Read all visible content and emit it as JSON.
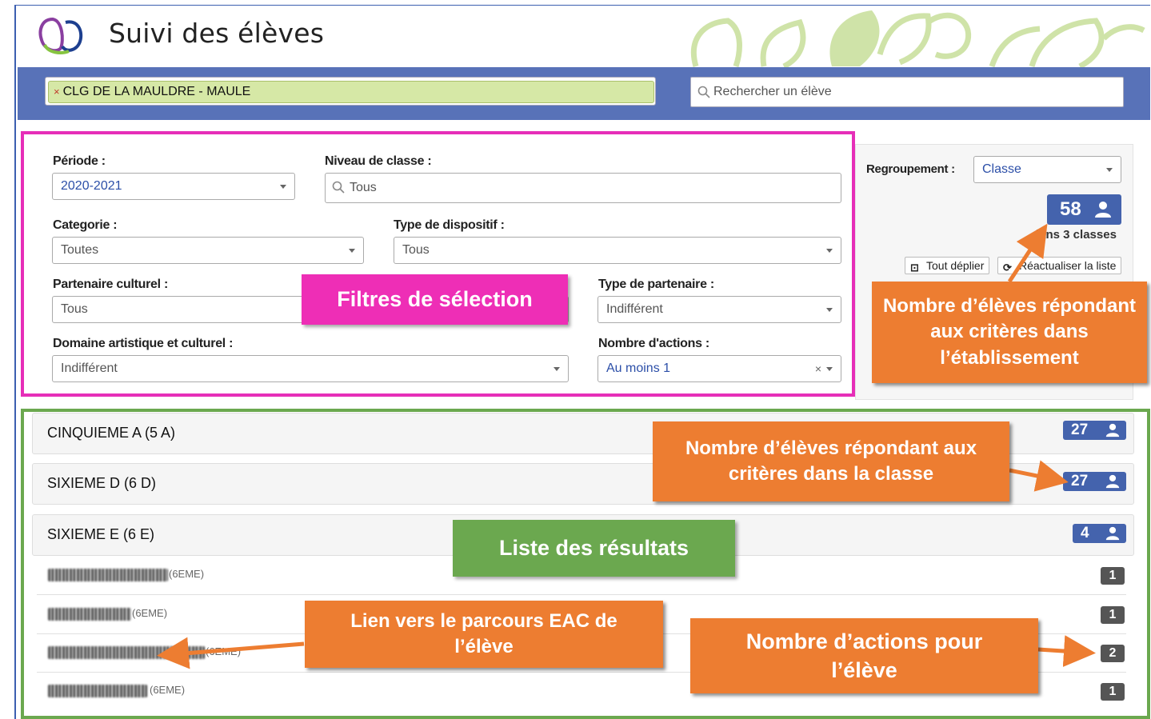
{
  "header": {
    "title": "Suivi des élèves"
  },
  "topbar": {
    "school_tag_remove": "×",
    "school_tag": "CLG DE LA MAULDRE - MAULE",
    "search_placeholder": "Rechercher un élève"
  },
  "filters": {
    "periode_label": "Période :",
    "periode_value": "2020-2021",
    "niveau_label": "Niveau de classe :",
    "niveau_value": "Tous",
    "categorie_label": "Categorie :",
    "categorie_value": "Toutes",
    "dispositif_label": "Type de dispositif :",
    "dispositif_value": "Tous",
    "partenaire_label": "Partenaire culturel :",
    "partenaire_value": "Tous",
    "type_partenaire_label": "Type de partenaire :",
    "type_partenaire_value": "Indifférent",
    "domaine_label": "Domaine artistique et culturel :",
    "domaine_value": "Indifférent",
    "nb_actions_label": "Nombre d'actions :",
    "nb_actions_value": "Au moins 1",
    "nb_actions_clear": "×"
  },
  "grouping": {
    "label": "Regroupement :",
    "value": "Classe",
    "total": "58",
    "classes_count": "dans 3 classes",
    "expand_label": "Tout déplier",
    "refresh_label": "Réactualiser la liste"
  },
  "results": {
    "groups": [
      {
        "title": "CINQUIEME A (5 A)",
        "count": "27"
      },
      {
        "title": "SIXIEME D (6 D)",
        "count": "27"
      },
      {
        "title": "SIXIEME E (6 E)",
        "count": "4"
      }
    ],
    "students": [
      {
        "level": "(6EME)",
        "actions": "1"
      },
      {
        "level": "(6EME)",
        "actions": "1"
      },
      {
        "level": "(6EME)",
        "actions": "2"
      },
      {
        "level": "(6EME)",
        "actions": "1"
      }
    ]
  },
  "annotations": {
    "filters": "Filtres de sélection",
    "total_students": "Nombre d’élèves répondant aux critères dans l’établissement",
    "class_students": "Nombre d’élèves répondant aux critères dans la classe",
    "results_list": "Liste des résultats",
    "eac_link": "Lien vers le parcours EAC de l’élève",
    "student_actions": "Nombre d’actions pour l’élève"
  },
  "colors": {
    "topbar": "#5872b8",
    "filter_border": "#e62eb8",
    "results_border": "#6ba84f",
    "annotation_orange": "#ed7d31",
    "badge_blue": "#4463ad",
    "school_tag": "#d6e8a6"
  }
}
